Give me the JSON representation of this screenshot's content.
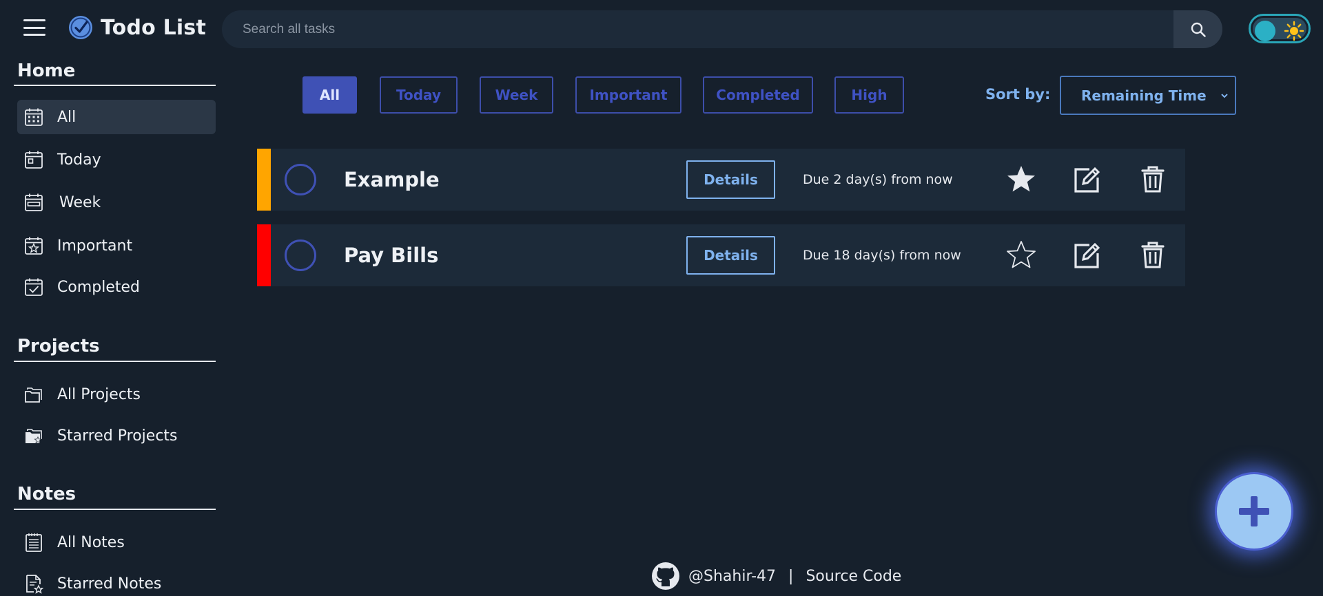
{
  "app": {
    "title": "Todo List"
  },
  "search": {
    "placeholder": "Search all tasks"
  },
  "theme_toggle": {
    "mode": "dark"
  },
  "sidebar": {
    "home": {
      "title": "Home",
      "items": [
        {
          "label": "All",
          "icon": "calendar-grid-icon",
          "active": true
        },
        {
          "label": "Today",
          "icon": "calendar-day-icon",
          "active": false
        },
        {
          "label": "Week",
          "icon": "calendar-week-icon",
          "active": false
        },
        {
          "label": "Important",
          "icon": "calendar-star-icon",
          "active": false
        },
        {
          "label": "Completed",
          "icon": "calendar-check-icon",
          "active": false
        }
      ]
    },
    "projects": {
      "title": "Projects",
      "items": [
        {
          "label": "All Projects",
          "icon": "folders-icon"
        },
        {
          "label": "Starred Projects",
          "icon": "folder-star-icon"
        }
      ]
    },
    "notes": {
      "title": "Notes",
      "items": [
        {
          "label": "All Notes",
          "icon": "notebook-icon"
        },
        {
          "label": "Starred Notes",
          "icon": "note-star-icon"
        }
      ]
    }
  },
  "filters": [
    {
      "label": "All",
      "active": true
    },
    {
      "label": "Today",
      "active": false
    },
    {
      "label": "Week",
      "active": false
    },
    {
      "label": "Important",
      "active": false
    },
    {
      "label": "Completed",
      "active": false
    },
    {
      "label": "High",
      "active": false
    }
  ],
  "sort": {
    "label": "Sort by:",
    "value": "Remaining Time"
  },
  "tasks": [
    {
      "title": "Example",
      "priority_color": "#ffa500",
      "details_label": "Details",
      "due": "Due 2 day(s) from now",
      "starred": true
    },
    {
      "title": "Pay Bills",
      "priority_color": "#ff0000",
      "details_label": "Details",
      "due": "Due 18 day(s) from now",
      "starred": false
    }
  ],
  "footer": {
    "user": "@Shahir-47",
    "separator": "|",
    "source": "Source Code"
  },
  "colors": {
    "background": "#16202c",
    "accent": "#3f51b5",
    "link": "#7fb2ee"
  }
}
